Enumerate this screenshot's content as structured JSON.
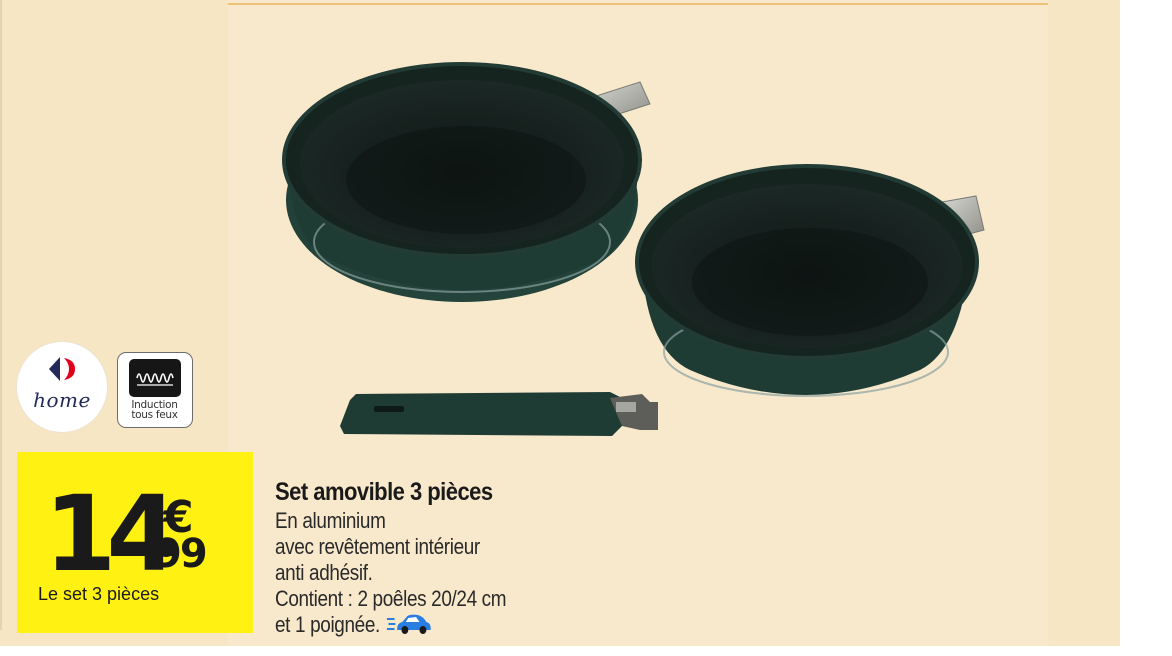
{
  "brand": {
    "logo_text": "home"
  },
  "badge": {
    "line1": "Induction",
    "line2": "tous feux",
    "icon": "induction-coil-icon"
  },
  "price": {
    "integer": "14",
    "currency": "€",
    "cents": "99",
    "unit": "Le set 3 pièces"
  },
  "product": {
    "title": "Set amovible 3 pièces",
    "description": [
      "En aluminium",
      "avec revêtement intérieur",
      "anti adhésif.",
      "Contient : 2 poêles 20/24 cm",
      "et 1 poignée."
    ],
    "delivery_icon": "delivery-car-icon"
  },
  "colors": {
    "background": "#f7e6c4",
    "price_box": "#fff212",
    "logo_blue": "#222a59",
    "pan": "#1f3a33",
    "delivery_blue": "#2a7de1"
  }
}
